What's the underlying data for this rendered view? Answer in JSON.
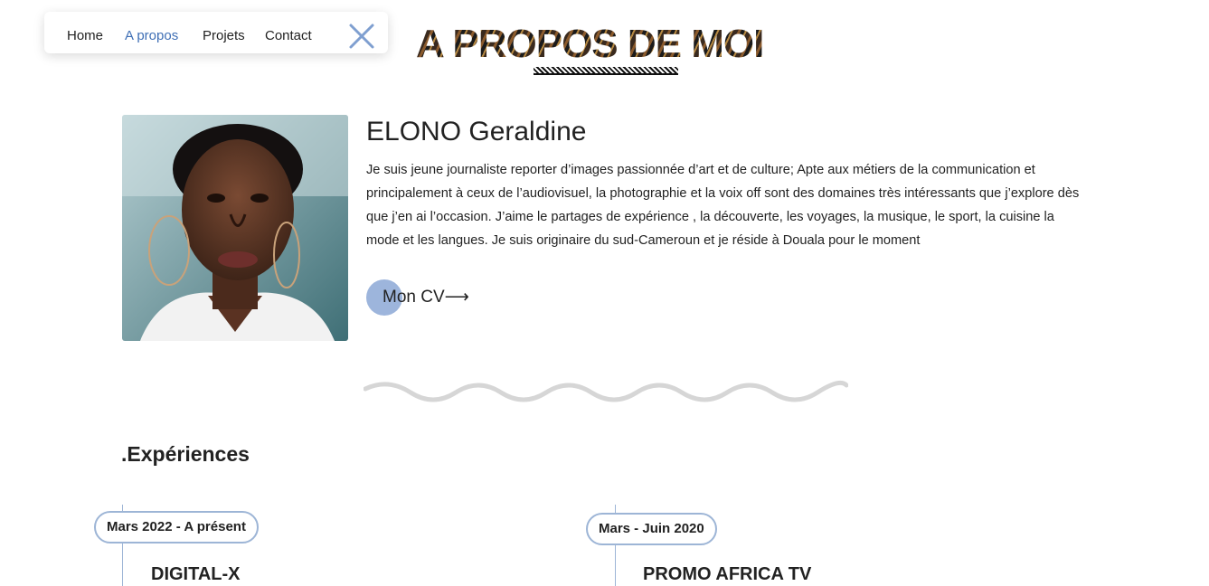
{
  "nav": {
    "items": [
      {
        "label": "Home",
        "active": false
      },
      {
        "label": "A propos",
        "active": true
      },
      {
        "label": "Projets",
        "active": false
      },
      {
        "label": "Contact",
        "active": false
      }
    ],
    "close_icon": "close-icon"
  },
  "page": {
    "title": "A PROPOS DE MOI"
  },
  "profile": {
    "name": "ELONO Geraldine",
    "bio": "Je suis jeune journaliste reporter d’images passionnée d’art et de culture; Apte aux métiers de la communication et principalement à ceux de l’audiovisuel, la photographie et la voix off sont des domaines très intéressants que j’explore dès que j’en ai l’occasion. J’aime le partages de expérience , la découverte, les voyages, la musique, le sport, la cuisine la mode et les langues. Je suis originaire du sud-Cameroun et je réside à Douala pour le moment",
    "cv_button": "Mon CV⟶"
  },
  "experiences": {
    "title": ".Expériences",
    "items": [
      {
        "period": "Mars 2022 - A présent",
        "company": "DIGITAL-X"
      },
      {
        "period": "Mars - Juin 2020",
        "company": "PROMO AFRICA TV"
      }
    ]
  },
  "colors": {
    "accent": "#3f6fb5",
    "accent_light": "#9db5dc",
    "timeline": "#9db5d6"
  }
}
